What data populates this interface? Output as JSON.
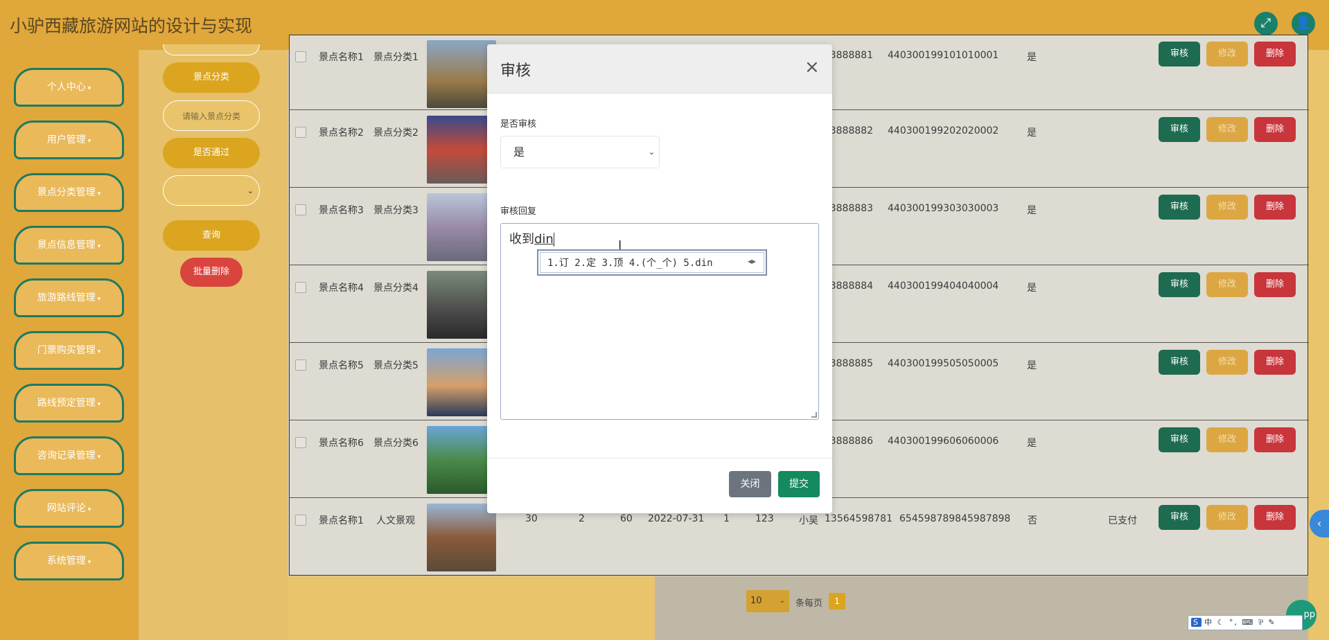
{
  "header": {
    "title": "小驴西藏旅游网站的设计与实现",
    "fullscreen_icon": "expand-icon",
    "user_icon": "user-icon"
  },
  "sidebar": {
    "items": [
      {
        "label": "个人中心"
      },
      {
        "label": "用户管理"
      },
      {
        "label": "景点分类管理"
      },
      {
        "label": "景点信息管理"
      },
      {
        "label": "旅游路线管理"
      },
      {
        "label": "门票购买管理"
      },
      {
        "label": "路线预定管理"
      },
      {
        "label": "咨询记录管理"
      },
      {
        "label": "网站评论"
      },
      {
        "label": "系统管理"
      }
    ],
    "caret": "▾"
  },
  "search": {
    "category_label": "景点分类",
    "category_placeholder": "请输入景点分类",
    "passed_label": "是否通过",
    "query_button": "查询",
    "batch_delete_button": "批量删除"
  },
  "table": {
    "rows": [
      {
        "name": "景点名称1",
        "category": "景点分类1",
        "phone": "3823888881",
        "idcard": "440300199101010001",
        "passed": "是",
        "extra": []
      },
      {
        "name": "景点名称2",
        "category": "景点分类2",
        "phone": "3823888882",
        "idcard": "440300199202020002",
        "passed": "是",
        "extra": []
      },
      {
        "name": "景点名称3",
        "category": "景点分类3",
        "phone": "3823888883",
        "idcard": "440300199303030003",
        "passed": "是",
        "extra": []
      },
      {
        "name": "景点名称4",
        "category": "景点分类4",
        "phone": "3823888884",
        "idcard": "440300199404040004",
        "passed": "是",
        "extra": []
      },
      {
        "name": "景点名称5",
        "category": "景点分类5",
        "phone": "3823888885",
        "idcard": "440300199505050005",
        "passed": "是",
        "extra": []
      },
      {
        "name": "景点名称6",
        "category": "景点分类6",
        "phone": "3823888886",
        "idcard": "440300199606060006",
        "passed": "是",
        "extra": []
      }
    ],
    "last_row": {
      "name": "景点名称1",
      "category": "人文景观",
      "price": "30",
      "qty": "2",
      "total": "60",
      "date": "2022-07-31",
      "num": "1",
      "account": "123",
      "user": "小吴",
      "phone": "13564598781",
      "idcard": "654598789845987898",
      "passed": "否",
      "pay": "已支付"
    },
    "audit_label": "审核",
    "edit_label": "修改",
    "delete_label": "删除"
  },
  "pager": {
    "page_size": "10",
    "per_page_label": "条每页",
    "current_page": "1"
  },
  "modal": {
    "title": "审核",
    "close_glyph": "×",
    "audit_label": "是否审核",
    "audit_value": "是",
    "reply_label": "审核回复",
    "reply_text_prefix": "收到",
    "reply_text_composing": "din",
    "close_button": "关闭",
    "submit_button": "提交"
  },
  "ime": {
    "candidates": "1.订 2.定 3.顶 4.(个_个) 5.din",
    "toolbar": "中 ☾ °, ⌨ ⅌ ✎"
  },
  "colors": {
    "header": "#e0a73a",
    "accent": "#19806a",
    "danger": "#c8353b",
    "gold": "#dba520"
  }
}
